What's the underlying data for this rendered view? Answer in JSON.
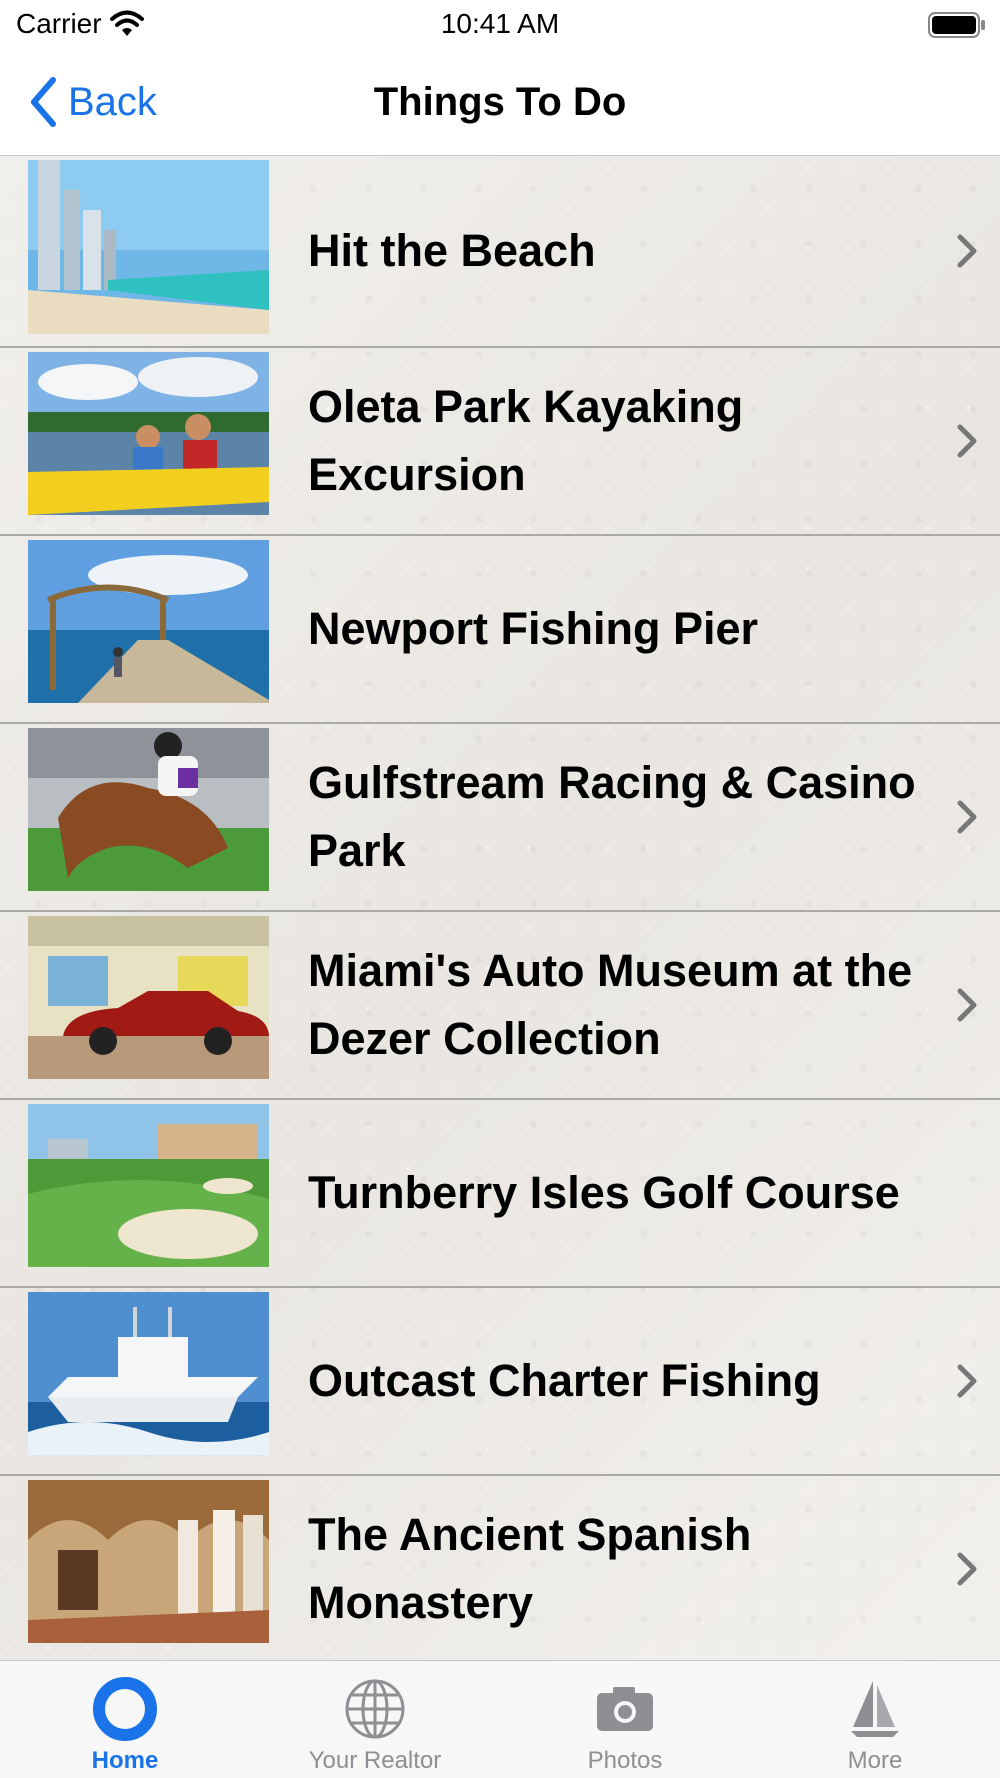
{
  "status_bar": {
    "carrier": "Carrier",
    "time": "10:41 AM"
  },
  "nav": {
    "back_label": "Back",
    "title": "Things To Do"
  },
  "items": [
    {
      "label": "Hit the Beach",
      "thumb": "beach-photo"
    },
    {
      "label": "Oleta Park Kayaking Excursion",
      "thumb": "kayak-photo"
    },
    {
      "label": "Newport Fishing Pier",
      "thumb": "pier-photo"
    },
    {
      "label": "Gulfstream Racing & Casino Park",
      "thumb": "horse-racing-photo"
    },
    {
      "label": "Miami's Auto Museum at the Dezer Collection",
      "thumb": "classic-car-photo"
    },
    {
      "label": "Turnberry Isles Golf Course",
      "thumb": "golf-course-photo"
    },
    {
      "label": "Outcast Charter Fishing",
      "thumb": "fishing-boat-photo"
    },
    {
      "label": "The Ancient Spanish Monastery",
      "thumb": "monastery-photo"
    }
  ],
  "tabs": [
    {
      "label": "Home",
      "icon": "lifebuoy-icon",
      "active": true
    },
    {
      "label": "Your Realtor",
      "icon": "globe-icon",
      "active": false
    },
    {
      "label": "Photos",
      "icon": "camera-icon",
      "active": false
    },
    {
      "label": "More",
      "icon": "sailboat-icon",
      "active": false
    }
  ],
  "colors": {
    "accent": "#1a73e8",
    "inactive_tab": "#8e8e93",
    "list_background": "#efedea",
    "separator": "#a9a9a9"
  }
}
